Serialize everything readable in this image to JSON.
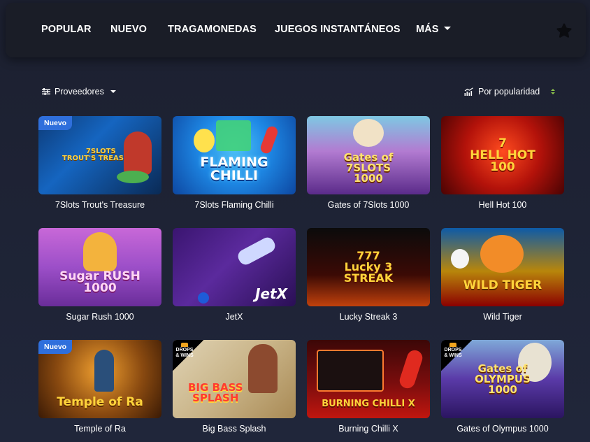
{
  "nav": {
    "items": [
      "POPULAR",
      "NUEVO",
      "TRAGAMONEDAS",
      "JUEGOS INSTANTÁNEOS",
      "MÁS"
    ],
    "favorites_icon": "star-icon"
  },
  "filters": {
    "providers_label": "Proveedores",
    "providers_icon": "sliders-icon",
    "sort_label": "Por popularidad",
    "sort_icon": "trending-chart-icon",
    "sort_accent": "#8bc34a"
  },
  "games": [
    {
      "title": "7Slots Trout's Treasure",
      "badge": "Nuevo",
      "art_text": "7SLOTS\nTROUT'S TREASURE"
    },
    {
      "title": "7Slots Flaming Chilli",
      "badge": "",
      "art_text": "FLAMING\nCHILLI"
    },
    {
      "title": "Gates of 7Slots 1000",
      "badge": "",
      "art_text": "Gates of\n7SLOTS\n1000"
    },
    {
      "title": "Hell Hot 100",
      "badge": "",
      "art_text": "7\nHELL HOT\n100"
    },
    {
      "title": "Sugar Rush 1000",
      "badge": "",
      "art_text": "Sugar RUSH\n1000"
    },
    {
      "title": "JetX",
      "badge": "",
      "art_text": "JetX"
    },
    {
      "title": "Lucky Streak 3",
      "badge": "",
      "art_text": "777\nLucky 3\nSTREAK"
    },
    {
      "title": "Wild Tiger",
      "badge": "",
      "art_text": "WILD TIGER"
    },
    {
      "title": "Temple of Ra",
      "badge": "Nuevo",
      "art_text": "Temple of Ra"
    },
    {
      "title": "Big Bass Splash",
      "badge": "DROPS & WINS",
      "art_text": "BIG BASS\nSPLASH"
    },
    {
      "title": "Burning Chilli X",
      "badge": "",
      "art_text": "BURNING CHILLI X"
    },
    {
      "title": "Gates of Olympus 1000",
      "badge": "DROPS & WINS",
      "art_text": "Gates of\nOLYMPUS\n1000"
    }
  ],
  "colors": {
    "badge_new": "#2f6fdc",
    "background": "#1e2230",
    "nav_bg": "#1a1d27"
  }
}
